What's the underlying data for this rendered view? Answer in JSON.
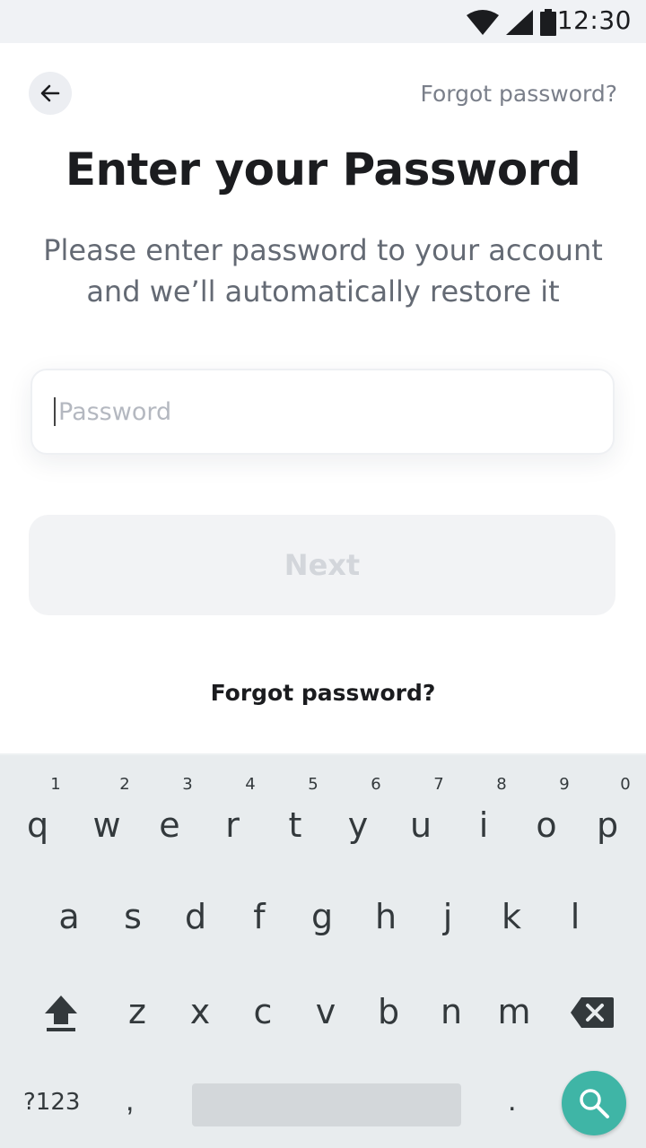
{
  "status_bar": {
    "time": "12:30"
  },
  "header": {
    "forgot_link": "Forgot password?"
  },
  "main": {
    "title": "Enter your Password",
    "subtitle": "Please enter password to your account and we’ll automatically restore it",
    "password_placeholder": "Password",
    "password_value": "",
    "next_label": "Next",
    "forgot_link": "Forgot password?"
  },
  "keyboard": {
    "row1": [
      {
        "k": "q",
        "h": "1"
      },
      {
        "k": "w",
        "h": "2"
      },
      {
        "k": "e",
        "h": "3"
      },
      {
        "k": "r",
        "h": "4"
      },
      {
        "k": "t",
        "h": "5"
      },
      {
        "k": "y",
        "h": "6"
      },
      {
        "k": "u",
        "h": "7"
      },
      {
        "k": "i",
        "h": "8"
      },
      {
        "k": "o",
        "h": "9"
      },
      {
        "k": "p",
        "h": "0"
      }
    ],
    "row2": [
      "a",
      "s",
      "d",
      "f",
      "g",
      "h",
      "j",
      "k",
      "l"
    ],
    "row3": [
      "z",
      "x",
      "c",
      "v",
      "b",
      "n",
      "m"
    ],
    "symbols_label": "?123",
    "comma": ",",
    "period": "."
  },
  "colors": {
    "accent": "#3fb5a6",
    "disabled_button": "#f2f3f5",
    "keyboard_bg": "#e8ecee"
  },
  "icons": [
    "wifi-icon",
    "signal-icon",
    "battery-icon",
    "back-arrow-icon",
    "shift-icon",
    "backspace-icon",
    "search-icon"
  ]
}
